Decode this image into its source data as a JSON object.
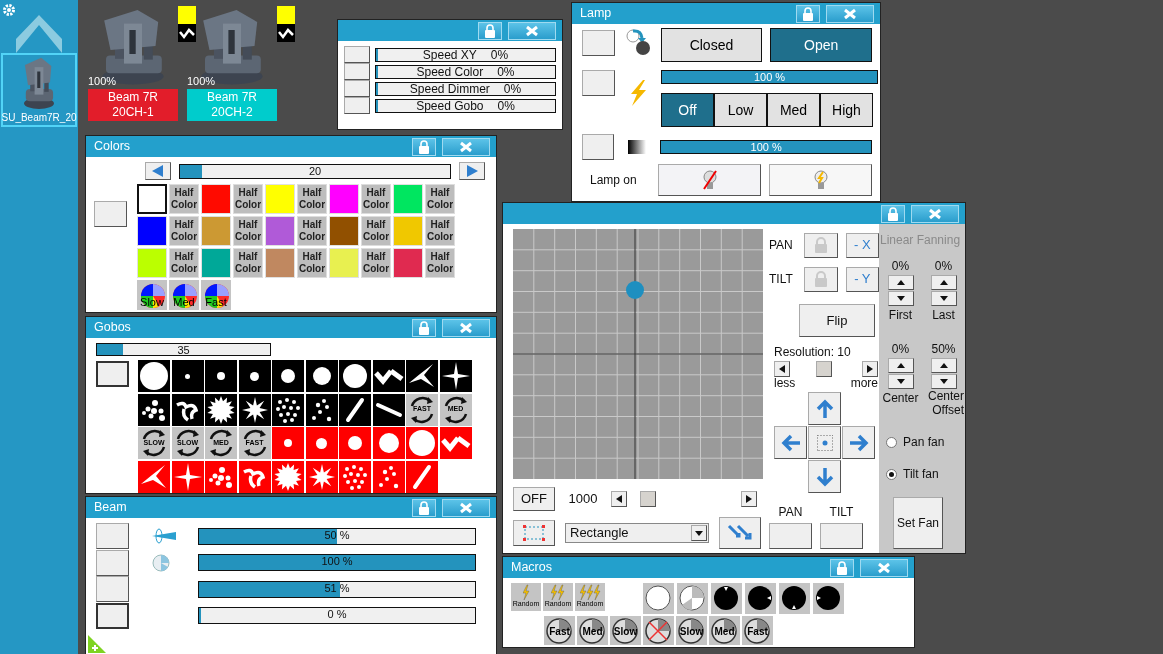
{
  "sidebar": {
    "thumbnail_label": "SU_Beam7R_20"
  },
  "fixtures": [
    {
      "intensity": "100%",
      "name": "Beam 7R",
      "channel": "20CH-1",
      "color": "#e21d2a",
      "indicator": {
        "color": "#ffff00"
      }
    },
    {
      "intensity": "100%",
      "name": "Beam 7R",
      "channel": "20CH-2",
      "color": "#00cccc",
      "indicator": {
        "color": "#ffff00"
      }
    }
  ],
  "speed": {
    "rows": [
      {
        "label": "Speed XY",
        "value": "0%",
        "level": 0
      },
      {
        "label": "Speed Color",
        "value": "0%",
        "level": 0
      },
      {
        "label": "Speed Dimmer",
        "value": "0%",
        "level": 0
      },
      {
        "label": "Speed Gobo",
        "value": "0%",
        "level": 0
      }
    ]
  },
  "lamp": {
    "title": "Lamp",
    "shutter": [
      {
        "label": "Closed",
        "selected": false
      },
      {
        "label": "Open",
        "selected": true
      }
    ],
    "dimmer": {
      "level": 1,
      "reading": "100 %"
    },
    "power": [
      {
        "label": "Off",
        "selected": true
      },
      {
        "label": "Low",
        "selected": false
      },
      {
        "label": "Med",
        "selected": false
      },
      {
        "label": "High",
        "selected": false
      }
    ],
    "fade": {
      "level": 1,
      "reading": "100 %"
    },
    "lamp_on_label": "Lamp on"
  },
  "colors": {
    "title": "Colors",
    "slider": {
      "level": 0.08,
      "reading": "20"
    },
    "swatches": [
      {
        "kind": "color",
        "color": "#ffffff",
        "selected": true
      },
      {
        "kind": "half",
        "label": "Half Color"
      },
      {
        "kind": "color",
        "color": "#ff0a00",
        "selected": false
      },
      {
        "kind": "half",
        "label": "Half Color"
      },
      {
        "kind": "color",
        "color": "#ffff00",
        "selected": false
      },
      {
        "kind": "half",
        "label": "Half Color"
      },
      {
        "kind": "color",
        "color": "#ff00ff",
        "selected": false
      },
      {
        "kind": "half",
        "label": "Half Color"
      },
      {
        "kind": "color",
        "color": "#00e660",
        "selected": false
      },
      {
        "kind": "half",
        "label": "Half Color"
      },
      {
        "kind": "color",
        "color": "#0000ff",
        "selected": false
      },
      {
        "kind": "half",
        "label": "Half Color"
      },
      {
        "kind": "color",
        "color": "#cc9933",
        "selected": false
      },
      {
        "kind": "half",
        "label": "Half Color"
      },
      {
        "kind": "color",
        "color": "#b05ad8",
        "selected": false
      },
      {
        "kind": "half",
        "label": "Half Color"
      },
      {
        "kind": "color",
        "color": "#915000",
        "selected": false
      },
      {
        "kind": "half",
        "label": "Half Color"
      },
      {
        "kind": "color",
        "color": "#f0c800",
        "selected": false
      },
      {
        "kind": "half",
        "label": "Half Color"
      },
      {
        "kind": "color",
        "color": "#bbff00",
        "selected": false
      },
      {
        "kind": "half",
        "label": "Half Color"
      },
      {
        "kind": "color",
        "color": "#00a898",
        "selected": false
      },
      {
        "kind": "half",
        "label": "Half Color"
      },
      {
        "kind": "color",
        "color": "#c08860",
        "selected": false
      },
      {
        "kind": "half",
        "label": "Half Color"
      },
      {
        "kind": "color",
        "color": "#e8f050",
        "selected": false
      },
      {
        "kind": "half",
        "label": "Half Color"
      },
      {
        "kind": "color",
        "color": "#e02a50",
        "selected": false
      },
      {
        "kind": "half",
        "label": "Half Color"
      },
      {
        "kind": "wheel",
        "label": "Slow"
      },
      {
        "kind": "wheel",
        "label": "Med"
      },
      {
        "kind": "wheel",
        "label": "Fast"
      }
    ]
  },
  "gobos": {
    "title": "Gobos",
    "slider": {
      "level": 0.15,
      "reading": "35"
    },
    "items": [
      {
        "kind": "gobo",
        "color": "#000000"
      },
      {
        "kind": "gobo",
        "color": "#000000"
      },
      {
        "kind": "gobo",
        "color": "#000000"
      },
      {
        "kind": "gobo",
        "color": "#000000"
      },
      {
        "kind": "gobo",
        "color": "#000000"
      },
      {
        "kind": "gobo",
        "color": "#000000"
      },
      {
        "kind": "gobo",
        "color": "#000000"
      },
      {
        "kind": "gobo",
        "color": "#000000"
      },
      {
        "kind": "gobo",
        "color": "#000000"
      },
      {
        "kind": "gobo",
        "color": "#000000"
      },
      {
        "kind": "gobo",
        "color": "#000000"
      },
      {
        "kind": "gobo",
        "color": "#000000"
      },
      {
        "kind": "gobo",
        "color": "#000000"
      },
      {
        "kind": "gobo",
        "color": "#000000"
      },
      {
        "kind": "gobo",
        "color": "#000000"
      },
      {
        "kind": "gobo",
        "color": "#000000"
      },
      {
        "kind": "gobo",
        "color": "#000000"
      },
      {
        "kind": "gobo",
        "color": "#000000"
      },
      {
        "kind": "rotation",
        "label": "FAST"
      },
      {
        "kind": "rotation",
        "label": "MED"
      },
      {
        "kind": "rotation",
        "label": "SLOW"
      },
      {
        "kind": "rotation",
        "label": "SLOW"
      },
      {
        "kind": "rotation",
        "label": "MED"
      },
      {
        "kind": "rotation",
        "label": "FAST"
      },
      {
        "kind": "gobo",
        "color": "#ff0000"
      },
      {
        "kind": "gobo",
        "color": "#ff0000"
      },
      {
        "kind": "gobo",
        "color": "#ff0000"
      },
      {
        "kind": "gobo",
        "color": "#ff0000"
      },
      {
        "kind": "gobo",
        "color": "#ff0000"
      },
      {
        "kind": "gobo",
        "color": "#ff0000"
      },
      {
        "kind": "gobo",
        "color": "#ff0000"
      },
      {
        "kind": "gobo",
        "color": "#ff0000"
      },
      {
        "kind": "gobo",
        "color": "#ff0000"
      },
      {
        "kind": "gobo",
        "color": "#ff0000"
      },
      {
        "kind": "gobo",
        "color": "#ff0000"
      },
      {
        "kind": "gobo",
        "color": "#ff0000"
      },
      {
        "kind": "gobo",
        "color": "#ff0000"
      },
      {
        "kind": "gobo",
        "color": "#ff0000"
      },
      {
        "kind": "gobo",
        "color": "#ff0000"
      }
    ]
  },
  "position": {
    "pan_label": "PAN",
    "tilt_label": "TILT",
    "invert_x": "- X",
    "invert_y": "- Y",
    "flip": "Flip",
    "resolution": "Resolution: 10",
    "resolution_slider": {
      "level": 0.45
    },
    "less": "less",
    "more": "more",
    "off": "OFF",
    "speed_value": "1000",
    "shape": "Rectangle",
    "pan_button_label": "PAN",
    "tilt_button_label": "TILT"
  },
  "fanning": {
    "title": "Linear Fanning",
    "first_value": "0%",
    "last_value": "0%",
    "first_label": "First",
    "last_label": "Last",
    "center_value": "0%",
    "offset_value": "50%",
    "center_label": "Center",
    "offset_label": "Center Offset",
    "modes": [
      {
        "label": "Pan fan",
        "selected": false
      },
      {
        "label": "Tilt fan",
        "selected": true
      }
    ],
    "set_button": "Set Fan"
  },
  "beam": {
    "title": "Beam",
    "bars": [
      {
        "level": 0.5,
        "reading": "50 %"
      },
      {
        "level": 1,
        "reading": "100 %"
      },
      {
        "level": 0.51,
        "reading": "51 %"
      },
      {
        "level": 0,
        "reading": "0 %"
      }
    ]
  },
  "macros": {
    "title": "Macros",
    "row_1": [
      {
        "kind": "random",
        "label": "Random"
      },
      {
        "kind": "random",
        "label": "Random"
      },
      {
        "kind": "random",
        "label": "Random"
      },
      {
        "kind": "dial"
      },
      {
        "kind": "dial"
      },
      {
        "kind": "dial"
      },
      {
        "kind": "dial"
      },
      {
        "kind": "dial"
      },
      {
        "kind": "dial"
      }
    ],
    "row_2": [
      {
        "kind": "speed",
        "label": "Fast"
      },
      {
        "kind": "speed",
        "label": "Med"
      },
      {
        "kind": "speed",
        "label": "Slow"
      },
      {
        "kind": "stop"
      },
      {
        "kind": "speed",
        "label": "Slow"
      },
      {
        "kind": "speed",
        "label": "Med"
      },
      {
        "kind": "speed",
        "label": "Fast"
      }
    ]
  }
}
